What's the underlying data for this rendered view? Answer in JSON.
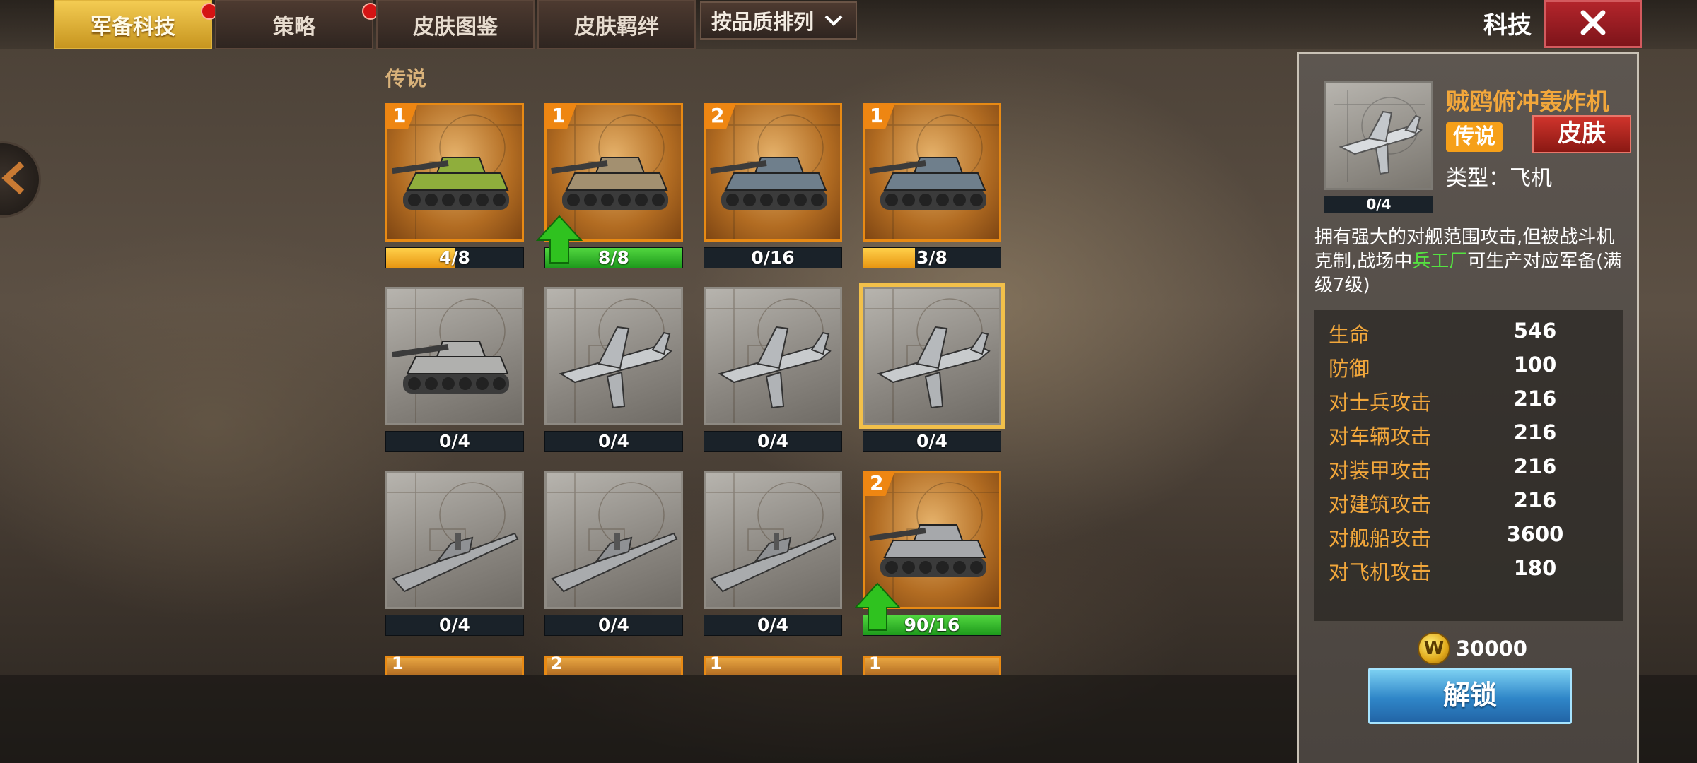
{
  "tabs": [
    {
      "label": "军备科技",
      "active": true,
      "red_dot": true
    },
    {
      "label": "策略",
      "active": false,
      "red_dot": true
    },
    {
      "label": "皮肤图鉴",
      "active": false,
      "red_dot": false
    },
    {
      "label": "皮肤羁绊",
      "active": false,
      "red_dot": false
    }
  ],
  "sort_dropdown": {
    "label": "按品质排列",
    "icon": "chevron-down-icon"
  },
  "header": {
    "title": "科技",
    "close_icon": "close-icon"
  },
  "section": {
    "title": "传说"
  },
  "cards": [
    {
      "level": "1",
      "progress": "4/8",
      "fill": 0.5,
      "fill_color": "orange",
      "unlocked": true,
      "unit": "tank-green",
      "up": false
    },
    {
      "level": "1",
      "progress": "8/8",
      "fill": 1.0,
      "fill_color": "green",
      "unlocked": true,
      "unit": "artillery-tan",
      "up": true
    },
    {
      "level": "2",
      "progress": "0/16",
      "fill": 0.0,
      "fill_color": "orange",
      "unlocked": true,
      "unit": "tank-tiger",
      "up": false
    },
    {
      "level": "1",
      "progress": "3/8",
      "fill": 0.375,
      "fill_color": "orange",
      "unlocked": true,
      "unit": "tank-destroyer",
      "up": false
    },
    {
      "level": "",
      "progress": "0/4",
      "fill": 0.0,
      "fill_color": "orange",
      "unlocked": false,
      "unit": "tank-gray",
      "up": false
    },
    {
      "level": "",
      "progress": "0/4",
      "fill": 0.0,
      "fill_color": "orange",
      "unlocked": false,
      "unit": "plane-fighter",
      "up": false
    },
    {
      "level": "",
      "progress": "0/4",
      "fill": 0.0,
      "fill_color": "orange",
      "unlocked": false,
      "unit": "plane-bomber",
      "up": false
    },
    {
      "level": "",
      "progress": "0/4",
      "fill": 0.0,
      "fill_color": "orange",
      "unlocked": false,
      "unit": "plane-stuka",
      "up": false,
      "selected": true
    },
    {
      "level": "",
      "progress": "0/4",
      "fill": 0.0,
      "fill_color": "orange",
      "unlocked": false,
      "unit": "ship-destroyer",
      "up": false
    },
    {
      "level": "",
      "progress": "0/4",
      "fill": 0.0,
      "fill_color": "orange",
      "unlocked": false,
      "unit": "ship-cruiser",
      "up": false
    },
    {
      "level": "",
      "progress": "0/4",
      "fill": 0.0,
      "fill_color": "orange",
      "unlocked": false,
      "unit": "ship-battleship",
      "up": false
    },
    {
      "level": "2",
      "progress": "90/16",
      "fill": 1.0,
      "fill_color": "green",
      "unlocked": true,
      "unit": "tank-maus",
      "up": true
    }
  ],
  "partial_cards": [
    {
      "level": "1"
    },
    {
      "level": "2"
    },
    {
      "level": "1"
    },
    {
      "level": "1"
    }
  ],
  "detail": {
    "thumb_progress": "0/4",
    "name": "贼鸥俯冲轰炸机",
    "rarity": "传说",
    "skin_button": "皮肤",
    "type_text": "类型：飞机",
    "description_pre": "拥有强大的对舰范围攻击,但被战斗机克制,战场中",
    "description_highlight": "兵工厂",
    "description_post": "可生产对应军备(满级7级)",
    "stats": [
      {
        "label": "生命",
        "value": "546"
      },
      {
        "label": "防御",
        "value": "100"
      },
      {
        "label": "对士兵攻击",
        "value": "216"
      },
      {
        "label": "对车辆攻击",
        "value": "216"
      },
      {
        "label": "对装甲攻击",
        "value": "216"
      },
      {
        "label": "对建筑攻击",
        "value": "216"
      },
      {
        "label": "对舰船攻击",
        "value": "3600"
      },
      {
        "label": "对飞机攻击",
        "value": "180"
      }
    ],
    "coin_symbol": "W",
    "cost": "30000",
    "unlock_button": "解锁"
  },
  "colors": {
    "accent_gold": "#f3cb52",
    "rarity_orange": "#f6a019",
    "stat_label": "#f2a73b",
    "highlight_green": "#55e241",
    "close_red": "#b3252b",
    "unlock_blue": "#2f86c8"
  }
}
